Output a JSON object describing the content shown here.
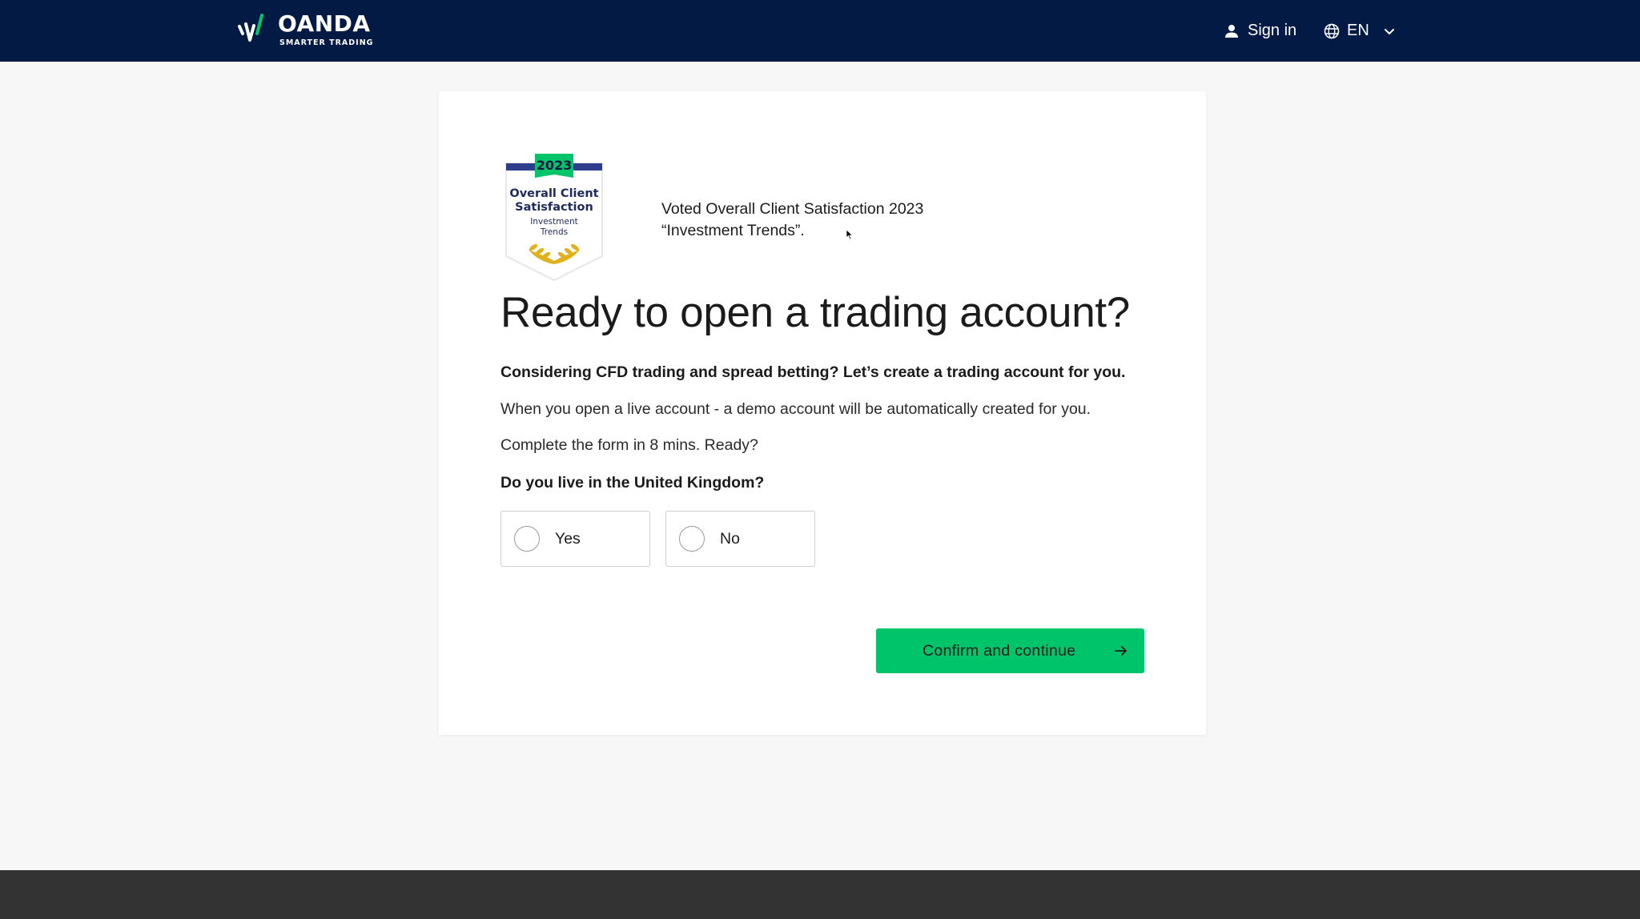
{
  "header": {
    "logo": {
      "name": "OANDA",
      "tagline": "SMARTER TRADING",
      "icon": "oanda-logo-mark-icon"
    },
    "sign_in": {
      "label": "Sign in",
      "icon": "person-icon"
    },
    "language": {
      "label": "EN",
      "icon": "globe-icon",
      "caret_icon": "chevron-down-icon"
    }
  },
  "award": {
    "badge": {
      "year": "2023",
      "line1": "Overall Client",
      "line2": "Satisfaction",
      "line3": "Investment",
      "line4": "Trends",
      "icon": "laurel-icon"
    },
    "caption_line1": "Voted Overall Client Satisfaction 2023",
    "caption_line2": "“Investment Trends”."
  },
  "main": {
    "title": "Ready to open a trading account?",
    "lead": "Considering CFD trading and spread betting? Let’s create a trading account for you.",
    "paragraph1": "When you open a live account - a demo account will be automatically created for you.",
    "paragraph2": "Complete the form in 8 mins. Ready?",
    "question": "Do you live in the United Kingdom?",
    "options": [
      {
        "label": "Yes",
        "selected": false
      },
      {
        "label": "No",
        "selected": false
      }
    ],
    "confirm": {
      "label": "Confirm and continue",
      "icon": "arrow-right-icon"
    }
  },
  "colors": {
    "header_bg": "#031a44",
    "accent_green": "#00c46a",
    "badge_blue": "#2e3e8c",
    "badge_gold": "#e0b11c",
    "footer_bg": "#333333",
    "page_bg": "#f7f7f7"
  }
}
